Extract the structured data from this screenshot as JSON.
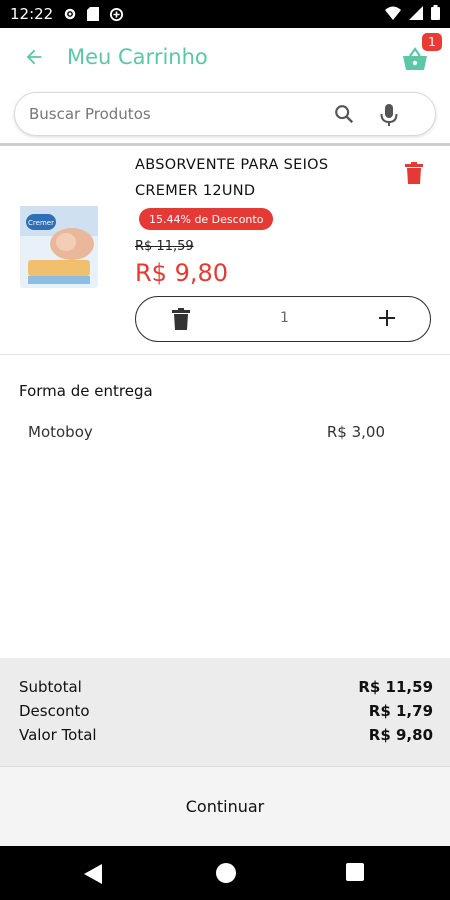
{
  "status_bar": {
    "time": "12:22"
  },
  "header": {
    "title": "Meu Carrinho",
    "cart_badge": "1",
    "back_icon": "arrow-left-icon",
    "cart_icon": "basket-icon"
  },
  "search": {
    "placeholder": "Buscar Produtos",
    "search_icon": "magnifier-icon",
    "mic_icon": "microphone-icon"
  },
  "cart": {
    "items": [
      {
        "name": "ABSORVENTE PARA SEIOS CREMER 12UND",
        "discount_label": "15.44% de Desconto",
        "old_price": "R$ 11,59",
        "price": "R$ 9,80",
        "quantity": "1",
        "image_brand": "Cremer"
      }
    ]
  },
  "delivery": {
    "title": "Forma de entrega",
    "method": "Motoboy",
    "price": "R$ 3,00"
  },
  "summary": {
    "subtotal_label": "Subtotal",
    "subtotal_value": "R$ 11,59",
    "discount_label": "Desconto",
    "discount_value": "R$ 1,79",
    "total_label": "Valor Total",
    "total_value": "R$ 9,80"
  },
  "continue_label": "Continuar",
  "colors": {
    "accent": "#5bc7a6",
    "discount_red": "#e53935",
    "badge_red": "#e83b34"
  }
}
